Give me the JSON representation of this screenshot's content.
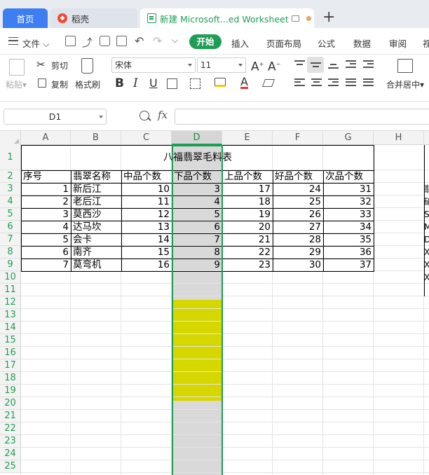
{
  "tabs": {
    "home": "首页",
    "docer": "稻壳",
    "sheet": "新建 Microsoft...ed Worksheet",
    "add": "+"
  },
  "menu": {
    "file": "文件",
    "start": "开始",
    "items": [
      "插入",
      "页面布局",
      "公式",
      "数据",
      "审阅",
      "视"
    ]
  },
  "ribbon": {
    "paste": "粘贴",
    "cut": "剪切",
    "copy": "复制",
    "format_painter": "格式刷",
    "font_name": "宋体",
    "font_size": "11",
    "merge_center": "合并居中"
  },
  "formula_bar": {
    "name_box": "D1",
    "fx": "fx",
    "formula": ""
  },
  "sheet": {
    "columns": [
      "A",
      "B",
      "C",
      "D",
      "E",
      "F",
      "G",
      "H"
    ],
    "selected_column": "D",
    "rows": [
      "1",
      "2",
      "3",
      "4",
      "5",
      "6",
      "7",
      "8",
      "9",
      "10",
      "11",
      "12",
      "13",
      "14",
      "15",
      "16",
      "17",
      "18",
      "19",
      "20",
      "21",
      "22",
      "23",
      "24",
      "25"
    ],
    "title": "八福翡翠毛料表",
    "headers": [
      "序号",
      "翡翠名称",
      "中品个数",
      "下品个数",
      "上品个数",
      "好品个数",
      "次品个数"
    ],
    "data": [
      [
        "1",
        "新后江",
        "10",
        "3",
        "17",
        "24",
        "31"
      ],
      [
        "2",
        "老后江",
        "11",
        "4",
        "18",
        "25",
        "32"
      ],
      [
        "3",
        "莫西沙",
        "12",
        "5",
        "19",
        "26",
        "33"
      ],
      [
        "4",
        "达马坎",
        "13",
        "6",
        "20",
        "27",
        "34"
      ],
      [
        "5",
        "会卡",
        "14",
        "7",
        "21",
        "28",
        "35"
      ],
      [
        "6",
        "南齐",
        "15",
        "8",
        "22",
        "29",
        "36"
      ],
      [
        "7",
        "莫弯机",
        "16",
        "9",
        "23",
        "30",
        "37"
      ]
    ],
    "right_partial": [
      "翡",
      "硝",
      "S",
      "M",
      "D",
      "X",
      "X",
      "X"
    ],
    "highlight_color": "#d7d700",
    "accent_color": "#1f9d55"
  }
}
